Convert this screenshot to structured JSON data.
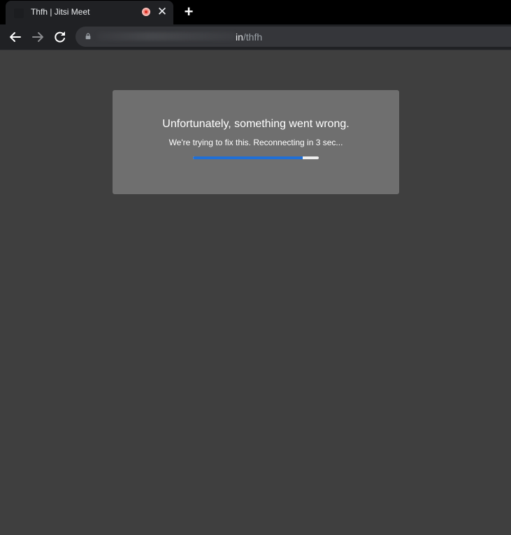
{
  "browser": {
    "tab": {
      "title": "Thfh | Jitsi Meet",
      "favicon": "jitsi-favicon",
      "recording_indicator": "recording-icon",
      "close_icon": "close-icon"
    },
    "new_tab_icon": "plus-icon",
    "toolbar": {
      "back_icon": "arrow-left-icon",
      "forward_icon": "arrow-right-icon",
      "reload_icon": "reload-icon",
      "lock_icon": "lock-icon",
      "url_host_visible": "in",
      "url_path": "/thfh"
    }
  },
  "dialog": {
    "title": "Unfortunately, something went wrong.",
    "message": "We're trying to fix this. Reconnecting in 3 sec...",
    "progress_fraction": 0.87
  },
  "colors": {
    "page_background": "#3f3f3f",
    "dialog_background": "#6f6f6f",
    "progress_fill": "#1f6fd6",
    "progress_track": "#eeeeee",
    "record_dot": "#d93025"
  }
}
